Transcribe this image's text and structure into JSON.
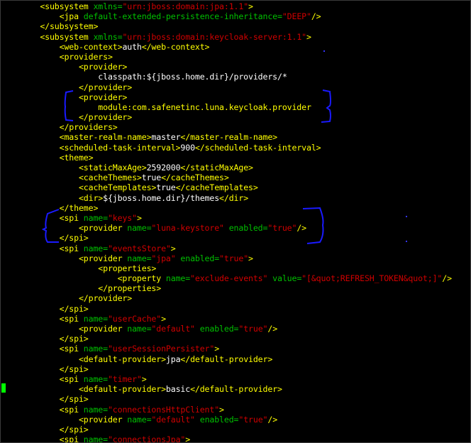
{
  "lines": [
    [
      [
        "tag",
        "    <subsystem "
      ],
      [
        "attr",
        "xmlns="
      ],
      [
        "val",
        "\"urn:jboss:domain:jpa:1.1\""
      ],
      [
        "tag",
        ">"
      ]
    ],
    [
      [
        "tag",
        "        <jpa "
      ],
      [
        "attr",
        "default-extended-persistence-inheritance="
      ],
      [
        "val",
        "\"DEEP\""
      ],
      [
        "tag",
        "/>"
      ]
    ],
    [
      [
        "tag",
        "    </subsystem>"
      ]
    ],
    [
      [
        "tag",
        "    <subsystem "
      ],
      [
        "attr",
        "xmlns="
      ],
      [
        "val",
        "\"urn:jboss:domain:keycloak-server:1.1\""
      ],
      [
        "tag",
        ">"
      ]
    ],
    [
      [
        "tag",
        "        <web-context>"
      ],
      [
        "text",
        "auth"
      ],
      [
        "tag",
        "</web-context>"
      ]
    ],
    [
      [
        "tag",
        "        <providers>"
      ]
    ],
    [
      [
        "tag",
        "            <provider>"
      ]
    ],
    [
      [
        "text",
        "                classpath:${jboss.home.dir}/providers/*"
      ]
    ],
    [
      [
        "tag",
        "            </provider>"
      ]
    ],
    [
      [
        "tag",
        "            <provider>"
      ]
    ],
    [
      [
        "tag",
        "                module:com.safenetinc.luna.keycloak.provider"
      ]
    ],
    [
      [
        "tag",
        "            </provider>"
      ]
    ],
    [
      [
        "tag",
        "        </providers>"
      ]
    ],
    [
      [
        "tag",
        "        <master-realm-name>"
      ],
      [
        "text",
        "master"
      ],
      [
        "tag",
        "</master-realm-name>"
      ]
    ],
    [
      [
        "tag",
        "        <scheduled-task-interval>"
      ],
      [
        "text",
        "900"
      ],
      [
        "tag",
        "</scheduled-task-interval>"
      ]
    ],
    [
      [
        "tag",
        "        <theme>"
      ]
    ],
    [
      [
        "tag",
        "            <staticMaxAge>"
      ],
      [
        "text",
        "2592000"
      ],
      [
        "tag",
        "</staticMaxAge>"
      ]
    ],
    [
      [
        "tag",
        "            <cacheThemes>"
      ],
      [
        "text",
        "true"
      ],
      [
        "tag",
        "</cacheThemes>"
      ]
    ],
    [
      [
        "tag",
        "            <cacheTemplates>"
      ],
      [
        "text",
        "true"
      ],
      [
        "tag",
        "</cacheTemplates>"
      ]
    ],
    [
      [
        "tag",
        "            <dir>"
      ],
      [
        "text",
        "${jboss.home.dir}/themes"
      ],
      [
        "tag",
        "</dir>"
      ]
    ],
    [
      [
        "tag",
        "        </theme>"
      ]
    ],
    [
      [
        "tag",
        "        <spi "
      ],
      [
        "attr",
        "name="
      ],
      [
        "val",
        "\"keys\""
      ],
      [
        "tag",
        ">"
      ]
    ],
    [
      [
        "tag",
        "            <provider "
      ],
      [
        "attr",
        "name="
      ],
      [
        "val",
        "\"luna-keystore\""
      ],
      [
        "attr",
        " enabled="
      ],
      [
        "val",
        "\"true\""
      ],
      [
        "tag",
        "/>"
      ]
    ],
    [
      [
        "tag",
        "        </spi>"
      ]
    ],
    [
      [
        "tag",
        "        <spi "
      ],
      [
        "attr",
        "name="
      ],
      [
        "val",
        "\"eventsStore\""
      ],
      [
        "tag",
        ">"
      ]
    ],
    [
      [
        "tag",
        "            <provider "
      ],
      [
        "attr",
        "name="
      ],
      [
        "val",
        "\"jpa\""
      ],
      [
        "attr",
        " enabled="
      ],
      [
        "val",
        "\"true\""
      ],
      [
        "tag",
        ">"
      ]
    ],
    [
      [
        "tag",
        "                <properties>"
      ]
    ],
    [
      [
        "tag",
        "                    <property "
      ],
      [
        "attr",
        "name="
      ],
      [
        "val",
        "\"exclude-events\""
      ],
      [
        "attr",
        " value="
      ],
      [
        "val",
        "\"[&quot;REFRESH_TOKEN&quot;]\""
      ],
      [
        "tag",
        "/>"
      ]
    ],
    [
      [
        "tag",
        "                </properties>"
      ]
    ],
    [
      [
        "tag",
        "            </provider>"
      ]
    ],
    [
      [
        "tag",
        "        </spi>"
      ]
    ],
    [
      [
        "tag",
        "        <spi "
      ],
      [
        "attr",
        "name="
      ],
      [
        "val",
        "\"userCache\""
      ],
      [
        "tag",
        ">"
      ]
    ],
    [
      [
        "tag",
        "            <provider "
      ],
      [
        "attr",
        "name="
      ],
      [
        "val",
        "\"default\""
      ],
      [
        "attr",
        " enabled="
      ],
      [
        "val",
        "\"true\""
      ],
      [
        "tag",
        "/>"
      ]
    ],
    [
      [
        "tag",
        "        </spi>"
      ]
    ],
    [
      [
        "tag",
        "        <spi "
      ],
      [
        "attr",
        "name="
      ],
      [
        "val",
        "\"userSessionPersister\""
      ],
      [
        "tag",
        ">"
      ]
    ],
    [
      [
        "tag",
        "            <default-provider>"
      ],
      [
        "text",
        "jpa"
      ],
      [
        "tag",
        "</default-provider>"
      ]
    ],
    [
      [
        "tag",
        "        </spi>"
      ]
    ],
    [
      [
        "tag",
        "        <spi "
      ],
      [
        "attr",
        "name="
      ],
      [
        "val",
        "\"timer\""
      ],
      [
        "tag",
        ">"
      ]
    ],
    [
      [
        "tag",
        "            <default-provider>"
      ],
      [
        "text",
        "basic"
      ],
      [
        "tag",
        "</default-provider>"
      ]
    ],
    [
      [
        "tag",
        "        </spi>"
      ]
    ],
    [
      [
        "tag",
        "        <spi "
      ],
      [
        "attr",
        "name="
      ],
      [
        "val",
        "\"connectionsHttpClient\""
      ],
      [
        "tag",
        ">"
      ]
    ],
    [
      [
        "tag",
        "            <provider "
      ],
      [
        "attr",
        "name="
      ],
      [
        "val",
        "\"default\""
      ],
      [
        "attr",
        " enabled="
      ],
      [
        "val",
        "\"true\""
      ],
      [
        "tag",
        "/>"
      ]
    ],
    [
      [
        "tag",
        "        </spi>"
      ]
    ],
    [
      [
        "tag",
        "        <spi "
      ],
      [
        "attr",
        "name="
      ],
      [
        "val",
        "\"connectionsJpa\""
      ],
      [
        "tag",
        ">"
      ]
    ]
  ],
  "colors": {
    "background": "#000000",
    "tag": "#ffff00",
    "attribute": "#00c000",
    "value": "#d00000",
    "text": "#ffffff",
    "annotation": "#1a1aff",
    "cursor": "#00ff00"
  }
}
